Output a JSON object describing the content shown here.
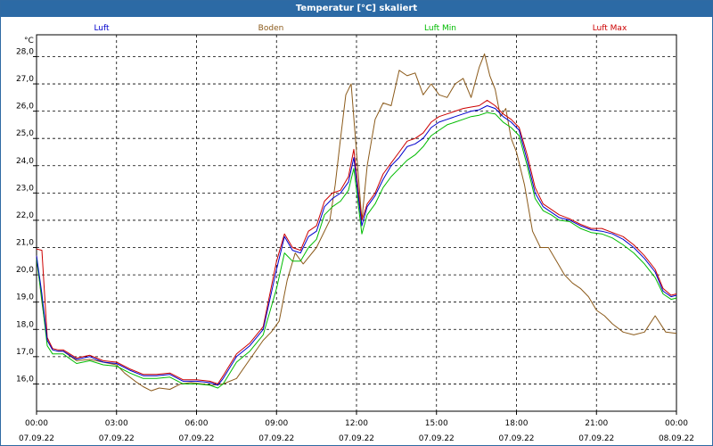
{
  "window": {
    "title": "Temperatur [°C] skaliert"
  },
  "chart_data": {
    "type": "line",
    "title": "Temperatur [°C] skaliert",
    "ylabel": "°C",
    "xlabel": "",
    "ylim": [
      15.0,
      28.8
    ],
    "xlim": [
      0,
      24
    ],
    "y_ticks": [
      "16,0",
      "17,0",
      "18,0",
      "19,0",
      "20,0",
      "21,0",
      "22,0",
      "23,0",
      "24,0",
      "25,0",
      "26,0",
      "27,0",
      "28,0"
    ],
    "y_tick_values": [
      16,
      17,
      18,
      19,
      20,
      21,
      22,
      23,
      24,
      25,
      26,
      27,
      28
    ],
    "x_tick_values": [
      0,
      3,
      6,
      9,
      12,
      15,
      18,
      21,
      24
    ],
    "x_tick_times": [
      "00:00",
      "03:00",
      "06:00",
      "09:00",
      "12:00",
      "15:00",
      "18:00",
      "21:00",
      "00:00"
    ],
    "x_tick_dates": [
      "07.09.22",
      "07.09.22",
      "07.09.22",
      "07.09.22",
      "07.09.22",
      "07.09.22",
      "07.09.22",
      "07.09.22",
      "08.09.22"
    ],
    "grid": true,
    "legend_position": "top",
    "series": [
      {
        "name": "Luft",
        "color": "#0000cc",
        "x": [
          0,
          0.2,
          0.4,
          0.6,
          0.8,
          1.0,
          1.5,
          2.0,
          2.5,
          3.0,
          3.5,
          4.0,
          4.5,
          5.0,
          5.5,
          6.0,
          6.5,
          6.8,
          7.0,
          7.5,
          8.0,
          8.5,
          9.0,
          9.3,
          9.6,
          9.9,
          10.2,
          10.5,
          10.8,
          11.1,
          11.4,
          11.7,
          11.9,
          12.1,
          12.2,
          12.4,
          12.7,
          13.0,
          13.3,
          13.6,
          13.9,
          14.2,
          14.5,
          14.8,
          15.1,
          15.4,
          15.7,
          16.0,
          16.3,
          16.6,
          16.9,
          17.2,
          17.5,
          17.8,
          18.1,
          18.4,
          18.7,
          19.0,
          19.3,
          19.6,
          20.0,
          20.4,
          20.8,
          21.2,
          21.6,
          22.0,
          22.4,
          22.8,
          23.2,
          23.5,
          23.8,
          24.0
        ],
        "values": [
          20.7,
          19.3,
          17.6,
          17.25,
          17.2,
          17.2,
          16.9,
          17.0,
          16.8,
          16.75,
          16.5,
          16.3,
          16.3,
          16.35,
          16.1,
          16.1,
          16.05,
          15.95,
          16.2,
          17.0,
          17.4,
          18.0,
          20.2,
          21.4,
          20.9,
          20.8,
          21.4,
          21.6,
          22.5,
          22.8,
          23.0,
          23.4,
          24.3,
          22.6,
          21.8,
          22.5,
          22.9,
          23.5,
          24.0,
          24.3,
          24.7,
          24.8,
          25.0,
          25.4,
          25.6,
          25.7,
          25.8,
          25.9,
          26.0,
          26.05,
          26.2,
          26.1,
          25.8,
          25.6,
          25.3,
          24.2,
          23.0,
          22.5,
          22.3,
          22.1,
          22.0,
          21.8,
          21.65,
          21.6,
          21.5,
          21.3,
          21.0,
          20.6,
          20.1,
          19.4,
          19.2,
          19.25
        ]
      },
      {
        "name": "Boden",
        "color": "#8b5a1a",
        "x": [
          0,
          0.2,
          0.4,
          0.6,
          0.8,
          1.0,
          1.5,
          2.0,
          2.5,
          3.0,
          3.3,
          3.7,
          4.0,
          4.3,
          4.6,
          5.0,
          5.4,
          5.8,
          6.2,
          6.6,
          7.0,
          7.5,
          8.0,
          8.5,
          8.8,
          9.1,
          9.4,
          9.7,
          10.0,
          10.5,
          11.0,
          11.2,
          11.4,
          11.6,
          11.8,
          12.0,
          12.2,
          12.4,
          12.7,
          13.0,
          13.3,
          13.6,
          13.9,
          14.2,
          14.5,
          14.8,
          15.1,
          15.4,
          15.7,
          16.0,
          16.3,
          16.6,
          16.8,
          17.0,
          17.2,
          17.4,
          17.6,
          17.8,
          18.0,
          18.3,
          18.6,
          18.9,
          19.2,
          19.5,
          19.8,
          20.1,
          20.4,
          20.7,
          21.0,
          21.3,
          21.6,
          22.0,
          22.4,
          22.8,
          23.2,
          23.6,
          24.0
        ],
        "values": [
          20.7,
          19.0,
          17.6,
          17.25,
          17.2,
          17.2,
          16.85,
          16.9,
          16.8,
          16.7,
          16.4,
          16.1,
          15.9,
          15.75,
          15.85,
          15.8,
          16.0,
          16.05,
          16.0,
          15.95,
          16.0,
          16.2,
          16.9,
          17.6,
          17.9,
          18.3,
          19.8,
          20.8,
          20.4,
          21.0,
          22.0,
          23.3,
          25.0,
          26.6,
          27.0,
          24.5,
          22.0,
          24.0,
          25.7,
          26.3,
          26.2,
          27.5,
          27.3,
          27.4,
          26.6,
          27.0,
          26.6,
          26.5,
          27.0,
          27.2,
          26.5,
          27.6,
          28.1,
          27.3,
          26.8,
          25.8,
          26.1,
          25.0,
          24.5,
          23.3,
          21.6,
          21.0,
          21.0,
          20.5,
          20.0,
          19.7,
          19.5,
          19.2,
          18.7,
          18.5,
          18.2,
          17.9,
          17.8,
          17.9,
          18.5,
          17.9,
          17.85
        ]
      },
      {
        "name": "Luft Min",
        "color": "#00bb00",
        "x": [
          0,
          0.2,
          0.4,
          0.6,
          0.8,
          1.0,
          1.5,
          2.0,
          2.5,
          3.0,
          3.5,
          4.0,
          4.5,
          5.0,
          5.5,
          6.0,
          6.5,
          6.8,
          7.0,
          7.5,
          8.0,
          8.5,
          9.0,
          9.3,
          9.6,
          9.9,
          10.2,
          10.5,
          10.8,
          11.1,
          11.4,
          11.7,
          11.9,
          12.1,
          12.2,
          12.4,
          12.7,
          13.0,
          13.3,
          13.6,
          13.9,
          14.2,
          14.5,
          14.8,
          15.1,
          15.4,
          15.7,
          16.0,
          16.3,
          16.6,
          16.9,
          17.2,
          17.5,
          17.8,
          18.1,
          18.4,
          18.7,
          19.0,
          19.3,
          19.6,
          20.0,
          20.4,
          20.8,
          21.2,
          21.6,
          22.0,
          22.4,
          22.8,
          23.2,
          23.5,
          23.8,
          24.0
        ],
        "values": [
          20.6,
          19.1,
          17.4,
          17.1,
          17.1,
          17.1,
          16.75,
          16.85,
          16.7,
          16.65,
          16.4,
          16.2,
          16.2,
          16.25,
          16.0,
          16.0,
          15.95,
          15.85,
          16.0,
          16.8,
          17.2,
          17.8,
          19.5,
          20.8,
          20.5,
          20.5,
          21.0,
          21.3,
          22.2,
          22.5,
          22.7,
          23.1,
          23.9,
          22.3,
          21.5,
          22.2,
          22.6,
          23.2,
          23.6,
          23.9,
          24.2,
          24.4,
          24.7,
          25.1,
          25.3,
          25.5,
          25.6,
          25.7,
          25.8,
          25.85,
          25.95,
          25.9,
          25.6,
          25.4,
          25.1,
          24.0,
          22.8,
          22.35,
          22.2,
          22.0,
          21.95,
          21.7,
          21.55,
          21.5,
          21.35,
          21.1,
          20.8,
          20.4,
          19.9,
          19.3,
          19.1,
          19.15
        ]
      },
      {
        "name": "Luft Max",
        "color": "#cc0000",
        "x": [
          0,
          0.2,
          0.4,
          0.6,
          0.8,
          1.0,
          1.5,
          2.0,
          2.5,
          3.0,
          3.5,
          4.0,
          4.5,
          5.0,
          5.5,
          6.0,
          6.5,
          6.8,
          7.0,
          7.5,
          8.0,
          8.5,
          9.0,
          9.3,
          9.6,
          9.9,
          10.2,
          10.5,
          10.8,
          11.1,
          11.4,
          11.7,
          11.9,
          12.1,
          12.2,
          12.4,
          12.7,
          13.0,
          13.3,
          13.6,
          13.9,
          14.2,
          14.5,
          14.8,
          15.1,
          15.4,
          15.7,
          16.0,
          16.3,
          16.6,
          16.9,
          17.2,
          17.5,
          17.8,
          18.1,
          18.4,
          18.7,
          19.0,
          19.3,
          19.6,
          20.0,
          20.4,
          20.8,
          21.2,
          21.6,
          22.0,
          22.4,
          22.8,
          23.2,
          23.5,
          23.8,
          24.0
        ],
        "values": [
          20.95,
          20.9,
          17.7,
          17.3,
          17.25,
          17.25,
          16.95,
          17.05,
          16.85,
          16.8,
          16.55,
          16.35,
          16.35,
          16.4,
          16.15,
          16.15,
          16.1,
          16.0,
          16.3,
          17.1,
          17.5,
          18.1,
          20.5,
          21.5,
          21.0,
          20.9,
          21.6,
          21.8,
          22.7,
          23.0,
          23.1,
          23.6,
          24.6,
          22.8,
          22.0,
          22.6,
          23.0,
          23.7,
          24.1,
          24.5,
          24.9,
          25.0,
          25.2,
          25.6,
          25.8,
          25.9,
          26.0,
          26.1,
          26.15,
          26.2,
          26.4,
          26.2,
          25.9,
          25.7,
          25.4,
          24.4,
          23.2,
          22.6,
          22.4,
          22.2,
          22.05,
          21.85,
          21.7,
          21.7,
          21.55,
          21.4,
          21.1,
          20.7,
          20.2,
          19.5,
          19.25,
          19.3
        ]
      }
    ]
  }
}
